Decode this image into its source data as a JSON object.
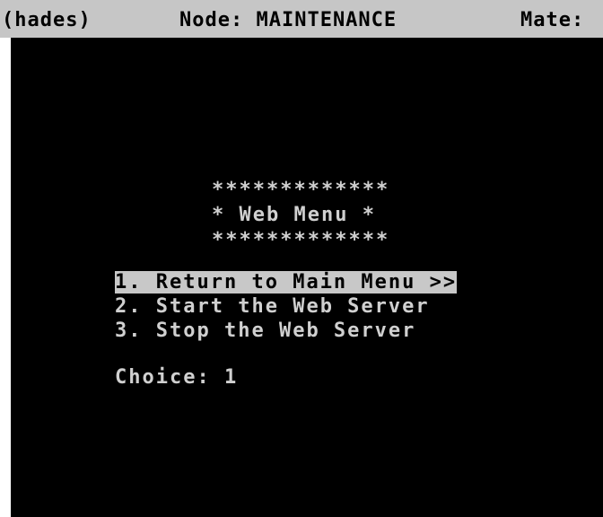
{
  "status_bar": {
    "user": "(hades)",
    "node": "Node: MAINTENANCE",
    "mate": "Mate:"
  },
  "banner": {
    "top": "*************",
    "title": "* Web Menu *",
    "bottom": "*************"
  },
  "menu": {
    "items": [
      {
        "number": "1.",
        "label": "Return to Main Menu >>",
        "selected": true
      },
      {
        "number": "2.",
        "label": "Start the Web Server",
        "selected": false
      },
      {
        "number": "3.",
        "label": "Stop the Web Server",
        "selected": false
      }
    ]
  },
  "prompt": {
    "label": "Choice:",
    "value": "1"
  },
  "colors": {
    "background": "#000000",
    "text": "#d0d0d0",
    "status_bar": "#c6c6c6",
    "highlight": "#c8c8c8"
  }
}
